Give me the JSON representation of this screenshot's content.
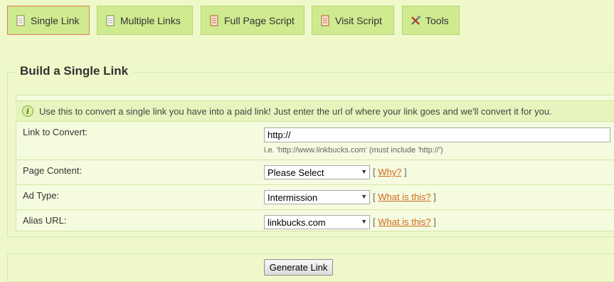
{
  "tabs": [
    {
      "label": "Single Link",
      "icon": "document-icon",
      "active": true
    },
    {
      "label": "Multiple Links",
      "icon": "document-icon"
    },
    {
      "label": "Full Page Script",
      "icon": "script-icon"
    },
    {
      "label": "Visit Script",
      "icon": "script-icon"
    },
    {
      "label": "Tools",
      "icon": "tools-icon"
    }
  ],
  "section": {
    "title": "Build a Single Link",
    "info": "Use this to convert a single link you have into a paid link! Just enter the url of where your link goes and we'll convert it for you."
  },
  "form": {
    "link_label": "Link to Convert:",
    "link_value": "http://",
    "link_hint": "i.e. 'http://www.linkbucks.com' (must include 'http://')",
    "page_content_label": "Page Content:",
    "page_content_value": "Please Select",
    "page_content_help": "Why?",
    "ad_type_label": "Ad Type:",
    "ad_type_value": "Intermission",
    "ad_type_help": "What is this?",
    "alias_label": "Alias URL:",
    "alias_value": "linkbucks.com",
    "alias_help": "What is this?",
    "bracket_open": "[",
    "bracket_close": "]"
  },
  "generate_label": "Generate Link",
  "colors": {
    "accent": "#d2691e",
    "tab_bg": "#cfeb8f",
    "page_bg": "#eef8c9",
    "active_border": "#e07a5a"
  }
}
